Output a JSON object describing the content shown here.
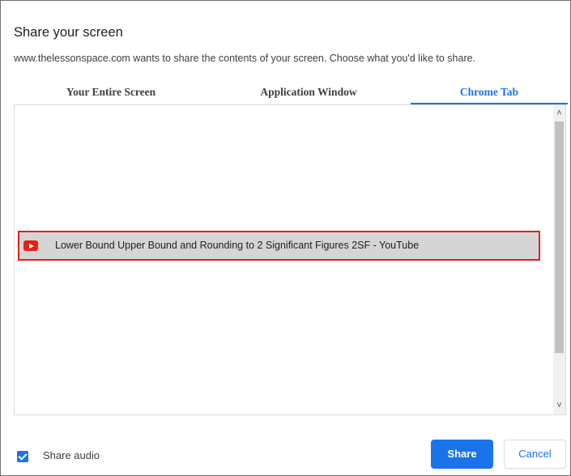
{
  "dialog": {
    "title": "Share your screen",
    "subtitle": "www.thelessonspace.com wants to share the contents of your screen. Choose what you'd like to share."
  },
  "tabs": [
    {
      "label": "Your Entire Screen",
      "selected": false
    },
    {
      "label": "Application Window",
      "selected": false
    },
    {
      "label": "Chrome Tab",
      "selected": true
    }
  ],
  "tab_list": {
    "items": [
      {
        "icon": "youtube-icon",
        "label": "Lower Bound Upper Bound and Rounding to 2 Significant Figures 2SF - YouTube",
        "selected": true
      }
    ]
  },
  "footer": {
    "share_audio": {
      "label": "Share audio",
      "checked": true
    },
    "share_button": "Share",
    "cancel_button": "Cancel"
  },
  "colors": {
    "accent": "#1a73e8",
    "highlight_border": "#e0201c",
    "youtube_red": "#e62117"
  }
}
